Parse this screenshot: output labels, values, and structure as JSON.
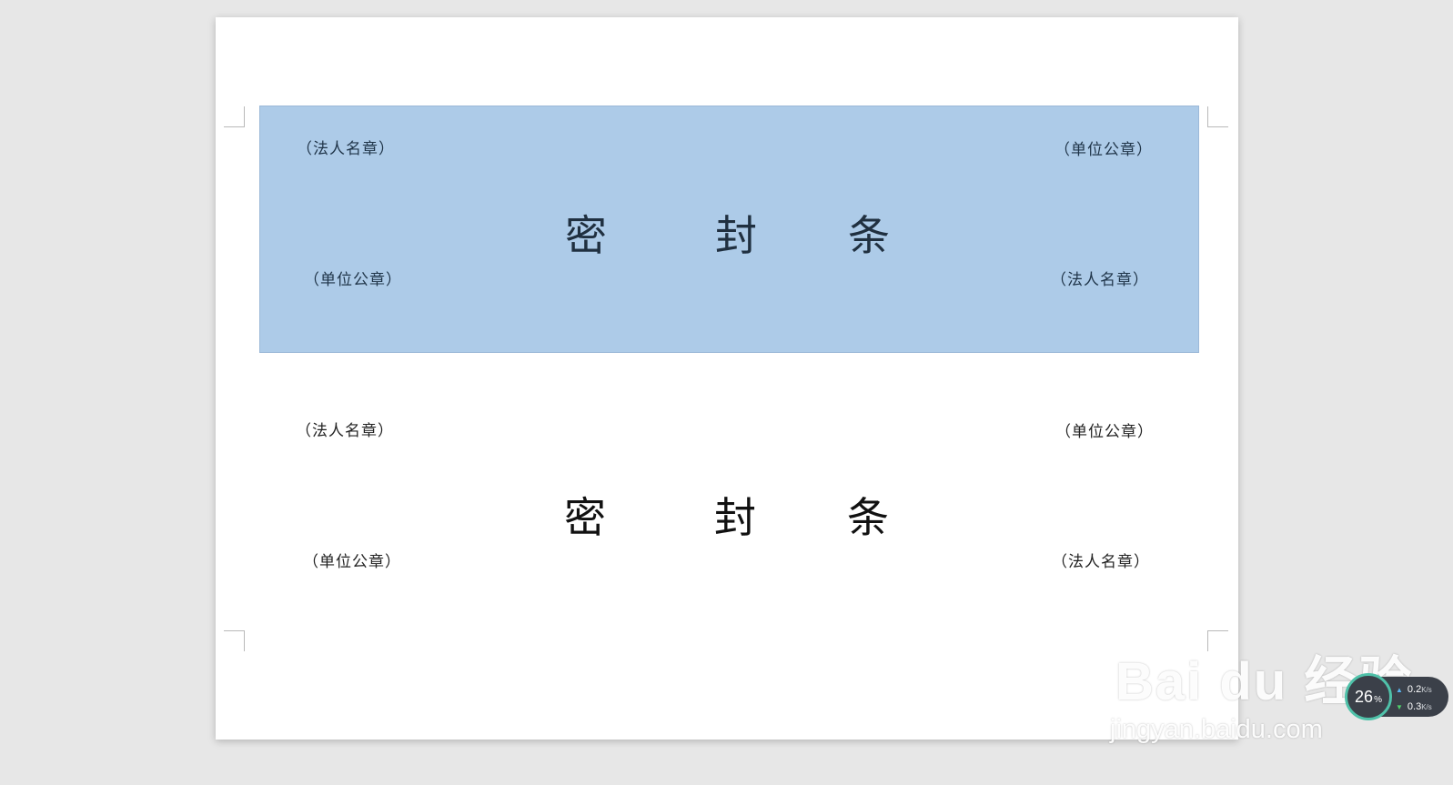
{
  "strips": [
    {
      "selected": true,
      "top_left": "（法人名章）",
      "top_right": "（单位公章）",
      "title_chars": [
        "密",
        "封",
        "条"
      ],
      "bottom_left": "（单位公章）",
      "bottom_right": "（法人名章）"
    },
    {
      "selected": false,
      "top_left": "（法人名章）",
      "top_right": "（单位公章）",
      "title_chars": [
        "密",
        "封",
        "条"
      ],
      "bottom_left": "（单位公章）",
      "bottom_right": "（法人名章）"
    }
  ],
  "watermark": {
    "logo": "Bai du 经验",
    "url": "jingyan.baidu.com"
  },
  "network_monitor": {
    "percent": "26",
    "percent_unit": "%",
    "upload": "0.2",
    "download": "0.3",
    "unit": "K/s",
    "upload_icon": "arrow-up-icon",
    "download_icon": "arrow-down-icon"
  },
  "colors": {
    "selection_fill": "#adcbe8",
    "background": "#e7e7e7",
    "page": "#ffffff"
  }
}
